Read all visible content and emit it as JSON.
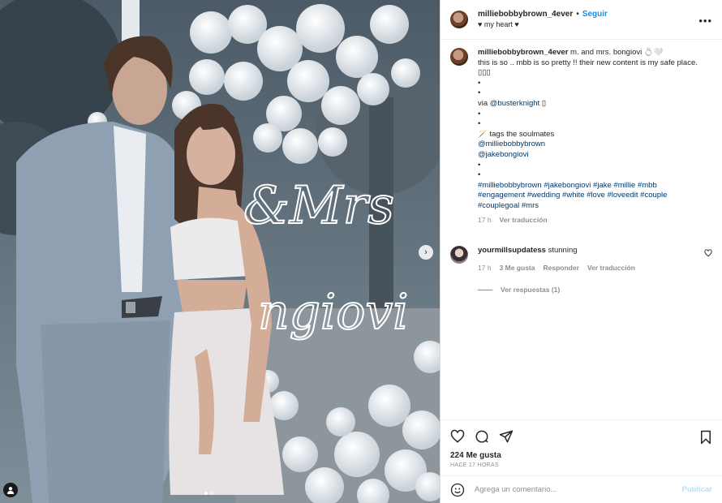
{
  "post": {
    "media": {
      "neon_sign_line1": "&Mrs",
      "neon_sign_line2": "ngiovi",
      "next_button": "›",
      "slide_count": 2,
      "active_slide": 1
    },
    "header": {
      "username": "milliebobbybrown_4ever",
      "separator": "•",
      "follow_label": "Seguir",
      "subtitle": "♥ my heart ♥",
      "more": "•••"
    },
    "caption": {
      "username": "milliebobbybrown_4ever",
      "line1": " m. and mrs. bongiovi 💍🤍",
      "line2": "this is so .. mbb is so pretty !! their new content is my safe place.",
      "line3": "▯▯▯",
      "bullet": "•",
      "via_prefix": "via ",
      "via_link": "@busterknight",
      "via_suffix": " ▯",
      "tags_line": "🪄 tags the soulmates",
      "mention1": "@milliebobbybrown",
      "mention2": "@jakebongiovi",
      "hashtags1": "#milliebobbybrown #jakebongiovi #jake #millie #mbb",
      "hashtags2": "#engagement #wedding #white #love #loveedit #couple",
      "hashtags3": "#couplegoal #mrs",
      "time": "17 h",
      "translate": "Ver traducción"
    },
    "comment": {
      "username": "yourmillsupdatess",
      "text": " stunning",
      "time": "17 h",
      "likes": "3 Me gusta",
      "reply": "Responder",
      "translate": "Ver traducción",
      "view_replies": "Ver respuestas (1)"
    },
    "actions": {
      "likes_label": "224 Me gusta",
      "timestamp": "HACE 17 HORAS"
    },
    "add_comment": {
      "placeholder": "Agrega un comentario...",
      "emoji_icon": "emoji-icon",
      "publish_label": "Publicar"
    }
  }
}
